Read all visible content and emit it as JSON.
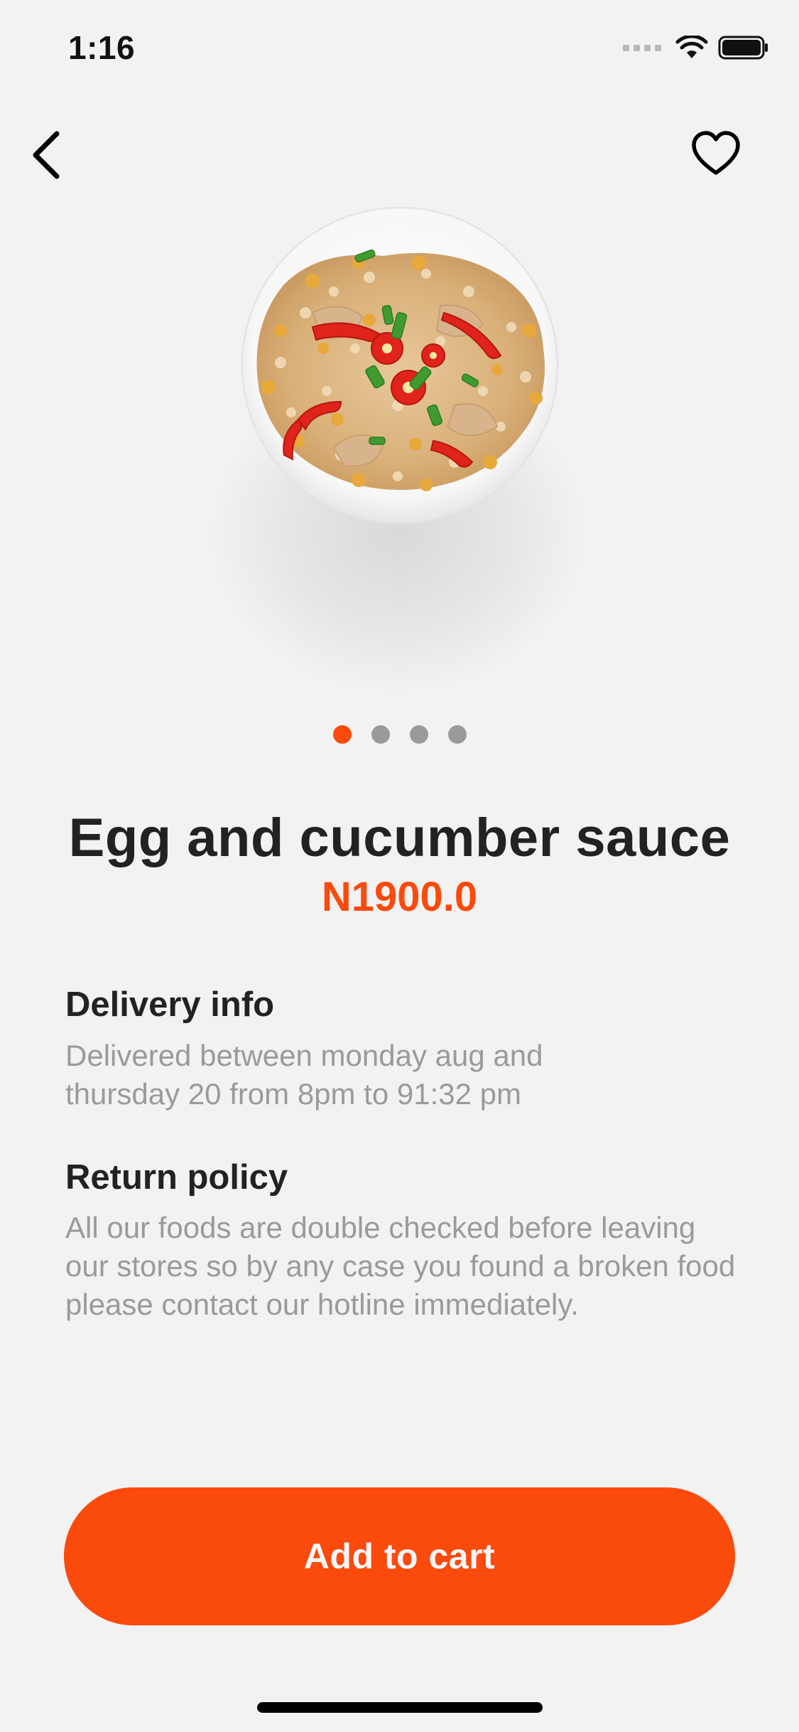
{
  "status_bar": {
    "time": "1:16"
  },
  "nav": {
    "back_icon": "chevron-left-icon",
    "favorite_icon": "heart-outline-icon"
  },
  "carousel": {
    "total": 4,
    "active_index": 0
  },
  "product": {
    "name": "Egg and cucumber sauce",
    "price": "N1900.0"
  },
  "delivery": {
    "title": "Delivery info",
    "body": "Delivered between monday aug and thursday 20 from 8pm to 91:32 pm"
  },
  "return_policy": {
    "title": "Return policy",
    "body": "All our foods are double checked before leaving our stores so by any case you found a broken food please contact our hotline immediately."
  },
  "cta": {
    "label": "Add to cart"
  },
  "colors": {
    "accent": "#fa4a0c",
    "background": "#f2f2f2",
    "muted_text": "#9a9a9a"
  }
}
